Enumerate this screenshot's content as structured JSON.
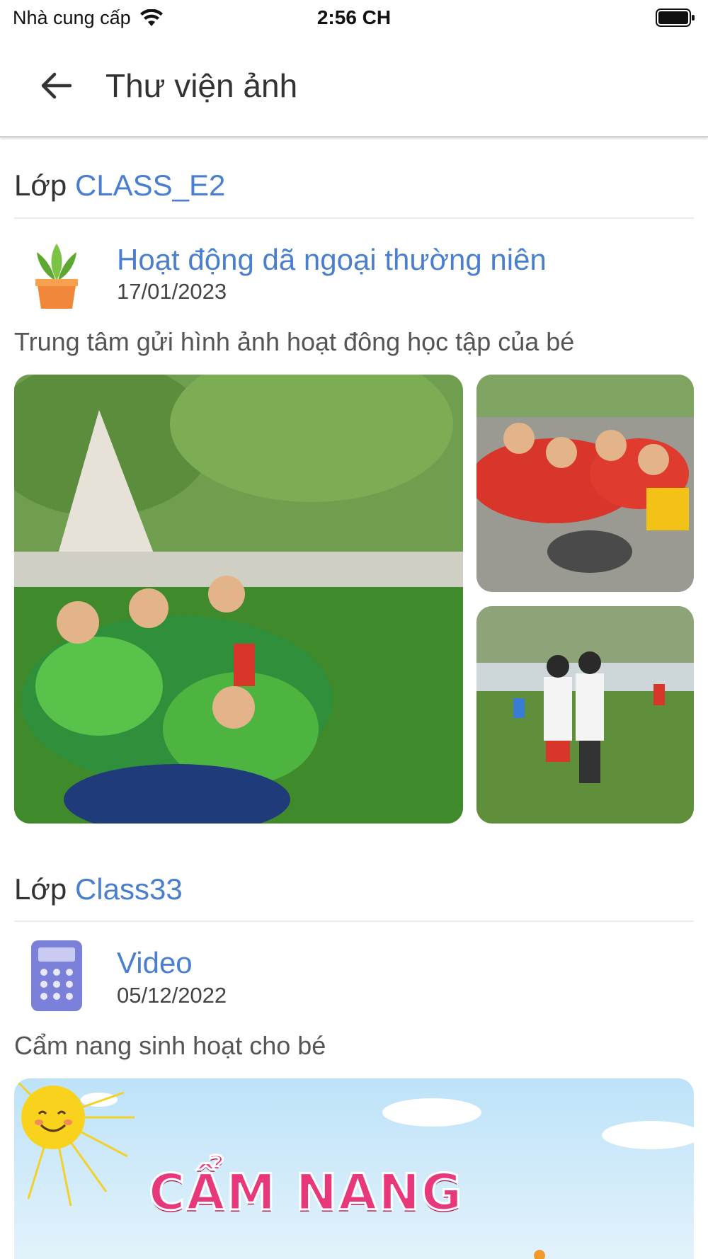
{
  "status_bar": {
    "carrier": "Nhà cung cấp",
    "time": "2:56 CH"
  },
  "app_bar": {
    "title": "Thư viện ảnh",
    "back_icon": "arrow-left-icon"
  },
  "sections": [
    {
      "prefix": "Lớp",
      "class_name": "CLASS_E2",
      "post": {
        "icon": "potted-plant-icon",
        "title": "Hoạt động dã ngoại thường niên",
        "date": "17/01/2023",
        "description": "Trung tâm gửi hình ảnh hoạt đông học tập của bé"
      }
    },
    {
      "prefix": "Lớp",
      "class_name": "Class33",
      "post": {
        "icon": "calculator-icon",
        "title": "Video",
        "date": "05/12/2022",
        "description": "Cẩm nang sinh hoạt cho bé",
        "banner_text": "CẨM NANG"
      }
    }
  ]
}
